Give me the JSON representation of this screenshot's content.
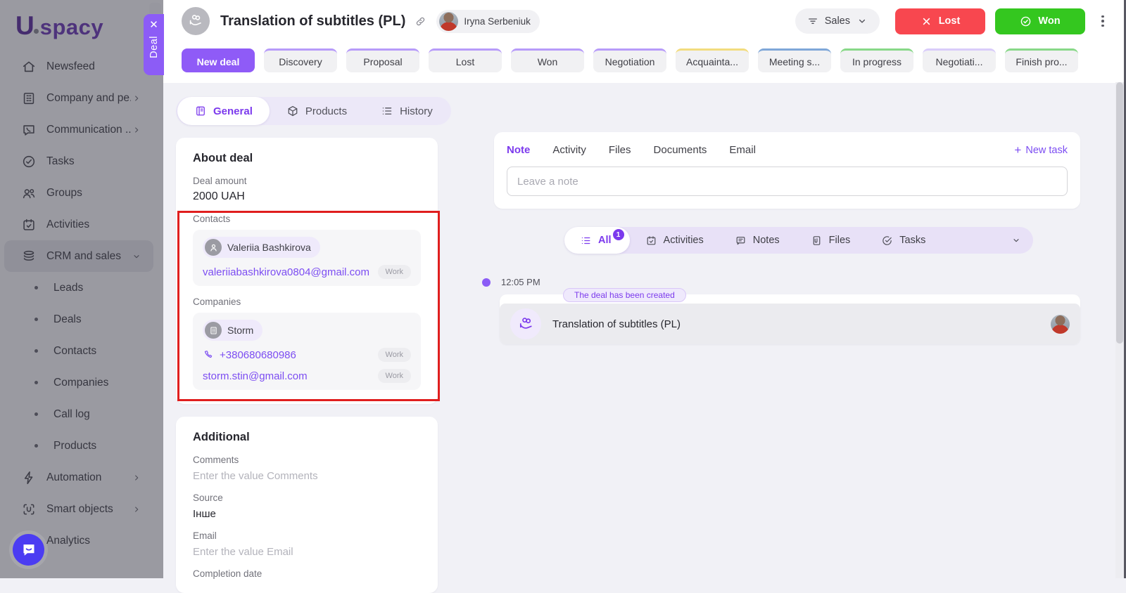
{
  "brand": {
    "name": "Uspacy",
    "logo_u": "U",
    "logo_rest": "spacy"
  },
  "colors": {
    "accent_purple": "#8b5cf6",
    "lost_red": "#f8474f",
    "won_green": "#34c71f",
    "annotation_red": "#e01e1e"
  },
  "sidebar": {
    "items": [
      {
        "label": "Newsfeed",
        "icon": "home-icon"
      },
      {
        "label": "Company and pe...",
        "icon": "building-icon",
        "chevron": "right"
      },
      {
        "label": "Communication ...",
        "icon": "chat-icon",
        "chevron": "right"
      },
      {
        "label": "Tasks",
        "icon": "tasks-icon"
      },
      {
        "label": "Groups",
        "icon": "groups-icon"
      },
      {
        "label": "Activities",
        "icon": "calendar-icon"
      },
      {
        "label": "CRM and sales",
        "icon": "crm-icon",
        "chevron": "down",
        "active": true
      },
      {
        "label": "Leads",
        "sub": true
      },
      {
        "label": "Deals",
        "sub": true
      },
      {
        "label": "Contacts",
        "sub": true
      },
      {
        "label": "Companies",
        "sub": true
      },
      {
        "label": "Call log",
        "sub": true
      },
      {
        "label": "Products",
        "sub": true
      },
      {
        "label": "Automation",
        "icon": "automation-icon",
        "chevron": "right"
      },
      {
        "label": "Smart objects",
        "icon": "smart-objects-icon",
        "chevron": "right"
      },
      {
        "label": "Analytics",
        "icon": "analytics-icon"
      }
    ]
  },
  "deal_panel_tab": {
    "label": "Deal",
    "close": "✕"
  },
  "header": {
    "title": "Translation of subtitles (PL)",
    "owner": "Iryna Serbeniuk",
    "funnel_label": "Sales",
    "lost_label": "Lost",
    "won_label": "Won"
  },
  "stages": [
    {
      "label": "New deal",
      "color": "#8f5bf7",
      "active": true
    },
    {
      "label": "Discovery",
      "color": "#b79bf9"
    },
    {
      "label": "Proposal",
      "color": "#b79bf9"
    },
    {
      "label": "Lost",
      "color": "#b79bf9"
    },
    {
      "label": "Won",
      "color": "#b79bf9"
    },
    {
      "label": "Negotiation",
      "color": "#b79bf9"
    },
    {
      "label": "Acquainta...",
      "color": "#f2dc7e"
    },
    {
      "label": "Meeting s...",
      "color": "#7fa7d8"
    },
    {
      "label": "In progress",
      "color": "#88d888"
    },
    {
      "label": "Negotiati...",
      "color": "#d9ccfa"
    },
    {
      "label": "Finish pro...",
      "color": "#88d888"
    }
  ],
  "view_tabs": [
    {
      "label": "General",
      "icon": "general-icon",
      "active": true
    },
    {
      "label": "Products",
      "icon": "products-icon"
    },
    {
      "label": "History",
      "icon": "history-icon"
    }
  ],
  "about": {
    "title": "About deal",
    "amount_label": "Deal amount",
    "amount_value": "2000 UAH",
    "contacts_label": "Contacts",
    "contact_name": "Valeriia Bashkirova",
    "contact_rows": [
      {
        "type": "email",
        "value": "valeriiabashkirova0804@gmail.com",
        "badge": "Work"
      }
    ],
    "companies_label": "Companies",
    "company_name": "Storm",
    "company_rows": [
      {
        "type": "phone",
        "value": "+380680680986",
        "badge": "Work"
      },
      {
        "type": "email",
        "value": "storm.stin@gmail.com",
        "badge": "Work"
      }
    ]
  },
  "additional": {
    "title": "Additional",
    "fields": [
      {
        "label": "Comments",
        "placeholder": "Enter the value Comments"
      },
      {
        "label": "Source",
        "value": "Інше"
      },
      {
        "label": "Email",
        "placeholder": "Enter the value Email"
      },
      {
        "label": "Completion date"
      }
    ]
  },
  "composer": {
    "tabs": [
      {
        "label": "Note",
        "active": true
      },
      {
        "label": "Activity"
      },
      {
        "label": "Files"
      },
      {
        "label": "Documents"
      },
      {
        "label": "Email"
      }
    ],
    "new_task_label": "New task",
    "note_placeholder": "Leave a note"
  },
  "filter_bar": {
    "items": [
      {
        "label": "All",
        "icon": "list-icon",
        "active": true,
        "badge": "1"
      },
      {
        "label": "Activities",
        "icon": "calendar-icon"
      },
      {
        "label": "Notes",
        "icon": "note-icon"
      },
      {
        "label": "Files",
        "icon": "file-icon"
      },
      {
        "label": "Tasks",
        "icon": "task-check-icon"
      }
    ]
  },
  "timeline": {
    "time": "12:05 PM",
    "event_label": "The deal has been created",
    "entry_title": "Translation of subtitles (PL)"
  }
}
